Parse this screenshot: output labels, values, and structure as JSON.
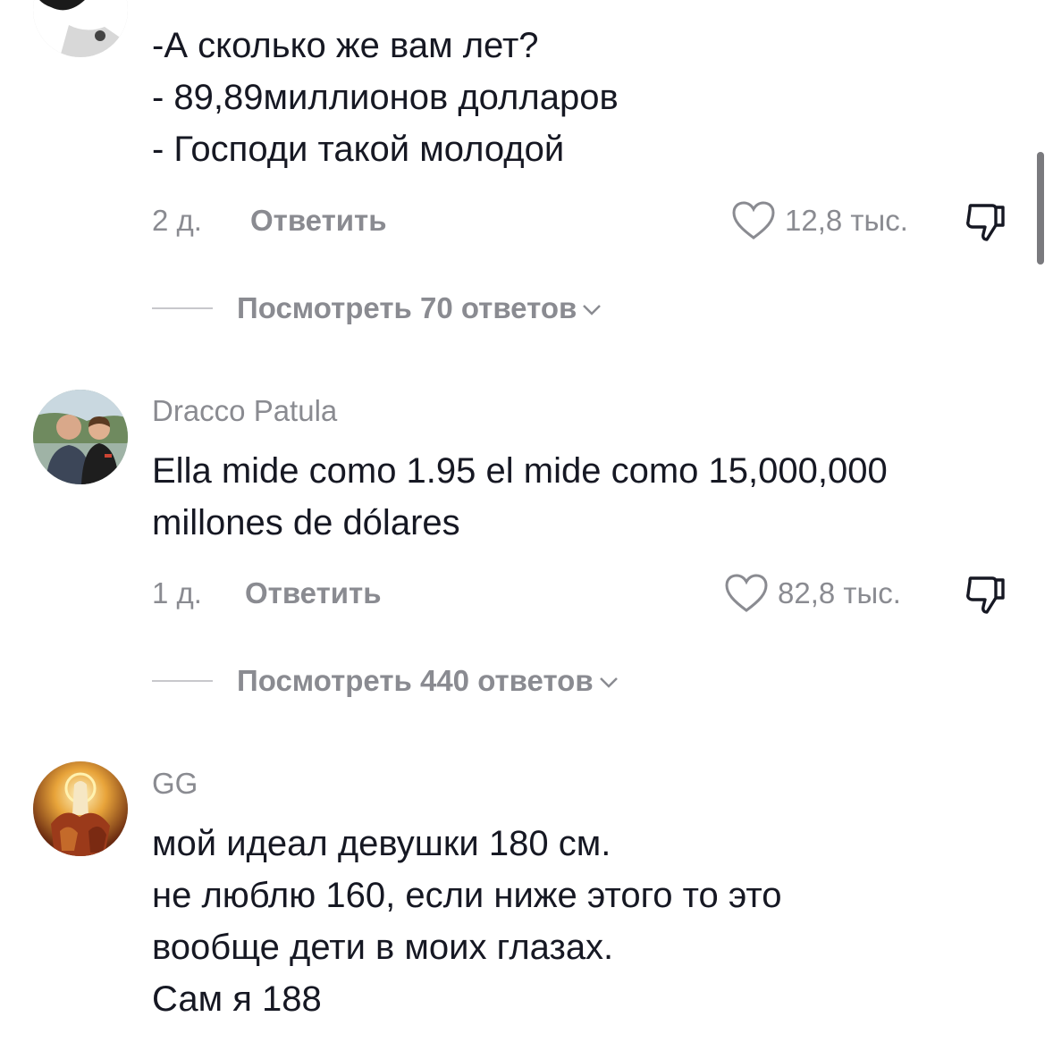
{
  "comments": [
    {
      "username": "",
      "lines": [
        "-А сколько же вам лет?",
        "- 89,89миллионов долларов",
        "- Господи такой молодой"
      ],
      "time": "2 д.",
      "reply_label": "Ответить",
      "likes": "12,8 тыс.",
      "view_replies": "Посмотреть 70 ответов"
    },
    {
      "username": "Dracco Patula",
      "lines": [
        "Ella mide como 1.95 el mide como 15,000,000",
        "millones de dólares"
      ],
      "time": "1 д.",
      "reply_label": "Ответить",
      "likes": "82,8 тыс.",
      "view_replies": "Посмотреть 440 ответов"
    },
    {
      "username": "GG",
      "lines": [
        "мой идеал девушки 180 см.",
        "не люблю 160, если ниже этого то это",
        "вообще дети в моих глазах.",
        "Сам я 188"
      ]
    }
  ],
  "icons": {
    "like": "heart-outline-icon",
    "dislike": "thumbs-down-icon",
    "expand": "chevron-down-icon"
  }
}
